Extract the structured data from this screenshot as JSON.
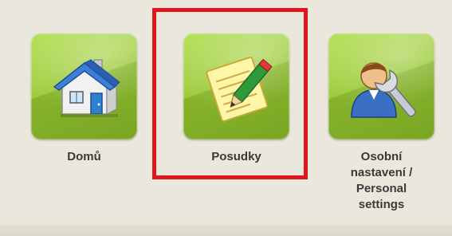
{
  "tiles": [
    {
      "id": "home",
      "label": "Domů",
      "icon": "house-icon"
    },
    {
      "id": "reviews",
      "label": "Posudky",
      "icon": "notepad-pencil-icon"
    },
    {
      "id": "settings",
      "label_lines": [
        "Osobní",
        "nastavení /",
        "Personal",
        "settings"
      ],
      "icon": "user-wrench-icon"
    }
  ],
  "colors": {
    "tile_green": "#9ccb3a",
    "highlight_red": "#e0161e",
    "background": "#eae7dc"
  }
}
